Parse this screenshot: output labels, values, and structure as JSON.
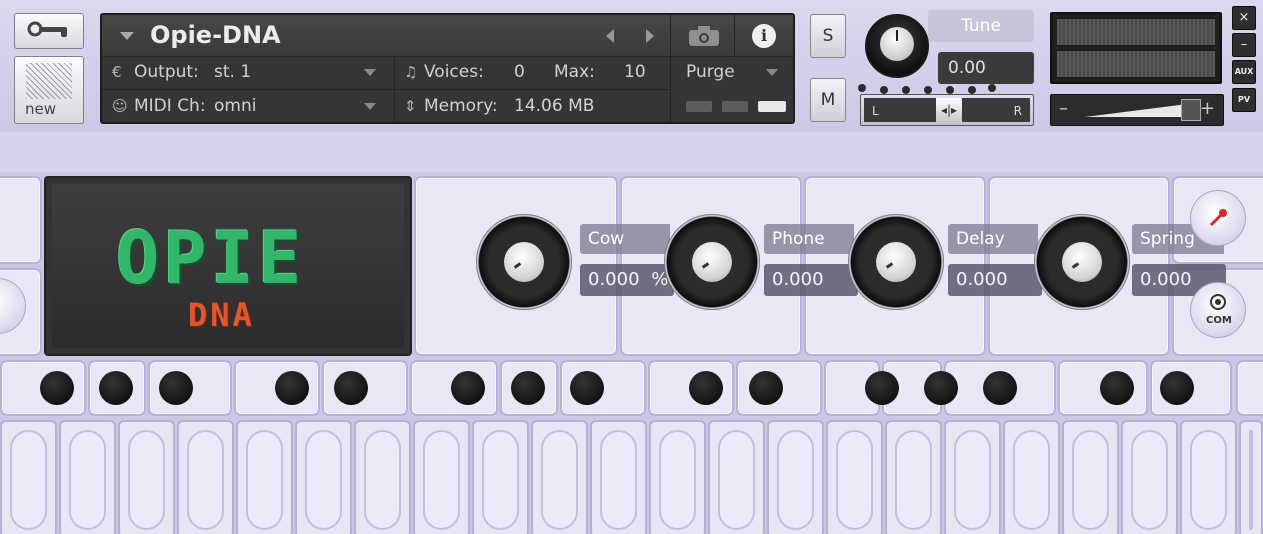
{
  "header": {
    "instrument_name": "Opie-DNA",
    "output_label": "Output:",
    "output_value": "st. 1",
    "midi_label": "MIDI Ch:",
    "midi_value": "omni",
    "voices_label": "Voices:",
    "voices_value": "0",
    "max_label": "Max:",
    "max_value": "10",
    "memory_label": "Memory:",
    "memory_value": "14.06 MB",
    "purge_label": "Purge",
    "new_label": "new",
    "solo_label": "S",
    "mute_label": "M",
    "tune_label": "Tune",
    "tune_value": "0.00",
    "pan_left": "L",
    "pan_right": "R",
    "vol_minus": "–",
    "vol_plus": "+",
    "close_glyph": "×",
    "minimize_glyph": "–",
    "aux_label": "AUX",
    "pv_label": "PV",
    "info_glyph": "i"
  },
  "instrument": {
    "logo_main": "OPIE",
    "logo_sub": "DNA",
    "params": [
      {
        "name": "Cow",
        "value": "0.000",
        "unit": "%"
      },
      {
        "name": "Phone",
        "value": "0.000",
        "unit": ""
      },
      {
        "name": "Delay",
        "value": "0.000",
        "unit": ""
      },
      {
        "name": "Spring",
        "value": "0.000",
        "unit": ""
      }
    ],
    "com_label": "COM"
  },
  "icons": {
    "wrench": "wrench-icon",
    "camera": "camera-icon",
    "info": "info-icon",
    "output": "output-icon",
    "midi": "midi-icon",
    "voices": "voices-icon",
    "memory": "memory-icon",
    "pin": "pin-icon",
    "com": "com-icon"
  },
  "colors": {
    "background": "#d3cfea",
    "panel": "#353535",
    "logo_green": "#33b56c",
    "logo_orange": "#e2572c",
    "pin_red": "#d8262f"
  }
}
